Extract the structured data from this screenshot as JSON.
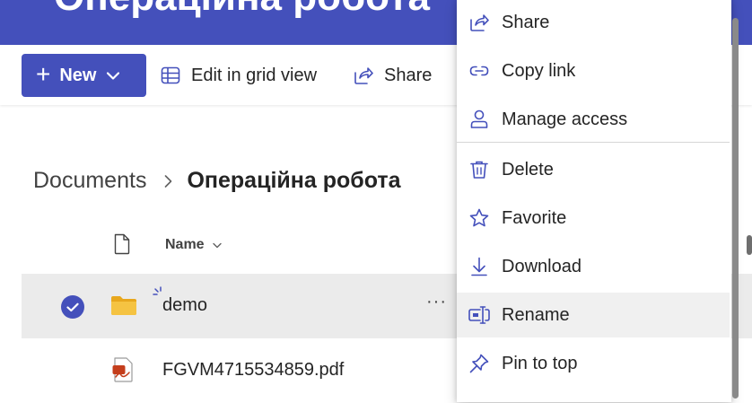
{
  "banner": {
    "title": "Операційна робота"
  },
  "command_bar": {
    "new_label": "New",
    "edit_grid_label": "Edit in grid view",
    "share_label": "Share"
  },
  "breadcrumb": {
    "root": "Documents",
    "current": "Операційна робота"
  },
  "list": {
    "name_header": "Name",
    "rows": [
      {
        "name": "demo",
        "type": "folder",
        "selected": true
      },
      {
        "name": "FGVM4715534859.pdf",
        "type": "pdf",
        "selected": false
      }
    ],
    "more_actions": "···"
  },
  "context_menu": {
    "items": [
      {
        "label": "Share",
        "icon": "share-icon"
      },
      {
        "label": "Copy link",
        "icon": "link-icon"
      },
      {
        "label": "Manage access",
        "icon": "person-icon"
      },
      {
        "label": "Delete",
        "icon": "trash-icon"
      },
      {
        "label": "Favorite",
        "icon": "star-icon"
      },
      {
        "label": "Download",
        "icon": "download-icon"
      },
      {
        "label": "Rename",
        "icon": "rename-icon"
      },
      {
        "label": "Pin to top",
        "icon": "pin-icon"
      }
    ],
    "hovered_item": "Rename"
  },
  "colors": {
    "brand": "#4450bb",
    "selected_row": "#ebebeb",
    "menu_hover": "#f0f0f0",
    "folder": "#f5c342",
    "pdf": "#c43e1c"
  }
}
